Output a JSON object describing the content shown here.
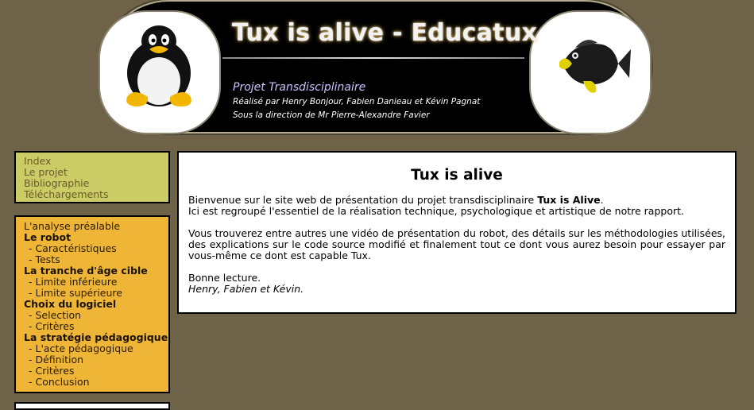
{
  "header": {
    "title": "Tux is alive - Educatux",
    "subtitle": "Projet Transdisciplinaire",
    "credits": "Réalisé par Henry Bonjour, Fabien Danieau et Kévin Pagnat",
    "supervision": "Sous la direction de Mr Pierre-Alexandre Favier"
  },
  "icons": {
    "left_mascot": "penguin-icon",
    "right_mascot": "fish-robot-icon"
  },
  "nav": {
    "items": [
      "Index",
      "Le projet",
      "Bibliographie",
      "Téléchargements"
    ]
  },
  "toc": {
    "items": [
      {
        "label": "L'analyse préalable",
        "kind": "plain"
      },
      {
        "label": "Le robot",
        "kind": "head"
      },
      {
        "label": "- Caractéristiques",
        "kind": "sub"
      },
      {
        "label": "- Tests",
        "kind": "sub"
      },
      {
        "label": "La tranche d'âge cible",
        "kind": "head"
      },
      {
        "label": "- Limite inférieure",
        "kind": "sub"
      },
      {
        "label": "- Limite supérieure",
        "kind": "sub"
      },
      {
        "label": "Choix du logiciel",
        "kind": "head"
      },
      {
        "label": "- Selection",
        "kind": "sub"
      },
      {
        "label": "- Critères",
        "kind": "sub"
      },
      {
        "label": "La stratégie pédagogique",
        "kind": "head"
      },
      {
        "label": "- L'acte pédagogique",
        "kind": "sub"
      },
      {
        "label": "- Définition",
        "kind": "sub"
      },
      {
        "label": "- Critères",
        "kind": "sub"
      },
      {
        "label": "- Conclusion",
        "kind": "sub"
      }
    ]
  },
  "main": {
    "heading": "Tux is alive",
    "intro_prefix": "Bienvenue sur le site web de présentation du projet transdisciplinaire ",
    "intro_bold": "Tux is Alive",
    "intro_suffix": ".",
    "intro_line2": "Ici est regroupé l'essentiel de la réalisation technique, psychologique et artistique de notre rapport.",
    "para2": "Vous trouverez entre autres une vidéo de présentation du robot, des détails sur les méthodologies utilisées, des explications sur le code source modifié et finalement tout ce dont vous aurez besoin pour essayer par vous-même ce dont est capable Tux.",
    "closing": "Bonne lecture.",
    "signature": "Henry, Fabien et Kévin."
  },
  "colors": {
    "page_bg": "#6e6349",
    "nav_bg": "#cccc66",
    "toc_bg": "#efb536",
    "link": "#6b5a2c",
    "subtitle": "#c9c5ff"
  }
}
